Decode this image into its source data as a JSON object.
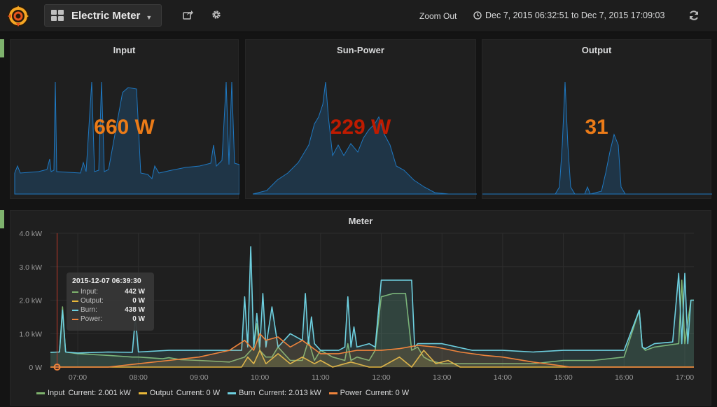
{
  "navbar": {
    "dashboard_title": "Electric Meter",
    "zoom_out_label": "Zoom Out",
    "time_range": "Dec 7, 2015 06:32:51 to Dec 7, 2015 17:09:03"
  },
  "panels": {
    "input": {
      "title": "Input",
      "value": "660 W",
      "color": "#eb7b18"
    },
    "sun_power": {
      "title": "Sun-Power",
      "value": "229 W",
      "color": "#bf1b00"
    },
    "output": {
      "title": "Output",
      "value": "31",
      "color": "#eb7b18"
    }
  },
  "meter": {
    "title": "Meter",
    "tooltip": {
      "time": "2015-12-07 06:39:30",
      "rows": [
        {
          "name": "Input:",
          "value": "442 W",
          "color": "#7eb26d"
        },
        {
          "name": "Output:",
          "value": "0 W",
          "color": "#eab839"
        },
        {
          "name": "Burn:",
          "value": "438 W",
          "color": "#6ed0e0"
        },
        {
          "name": "Power:",
          "value": "0 W",
          "color": "#ef843c"
        }
      ]
    },
    "legend": [
      {
        "name": "Input",
        "current": "Current: 2.001 kW",
        "color": "#7eb26d"
      },
      {
        "name": "Output",
        "current": "Current: 0 W",
        "color": "#eab839"
      },
      {
        "name": "Burn",
        "current": "Current: 2.013 kW",
        "color": "#6ed0e0"
      },
      {
        "name": "Power",
        "current": "Current: 0 W",
        "color": "#ef843c"
      }
    ]
  },
  "chart_data": {
    "type": "line",
    "title": "Meter",
    "y_ticks": [
      "0 W",
      "1.0 kW",
      "2.0 kW",
      "3.0 kW",
      "4.0 kW"
    ],
    "x_ticks": [
      "07:00",
      "08:00",
      "09:00",
      "10:00",
      "11:00",
      "12:00",
      "13:00",
      "14:00",
      "15:00",
      "16:00",
      "17:00"
    ],
    "ylim": [
      0,
      4.0
    ],
    "grid": true,
    "legend_position": "bottom",
    "series": [
      {
        "name": "Input",
        "color": "#7eb26d",
        "x": [
          6.55,
          6.7,
          6.75,
          6.8,
          7.0,
          7.5,
          7.9,
          8.0,
          8.4,
          8.5,
          8.7,
          9.0,
          9.5,
          9.75,
          9.9,
          9.95,
          10.0,
          10.1,
          10.2,
          10.3,
          10.5,
          10.7,
          10.8,
          10.9,
          11.0,
          11.2,
          11.4,
          11.45,
          11.5,
          11.6,
          11.8,
          11.9,
          12.0,
          12.2,
          12.4,
          12.5,
          12.6,
          12.7,
          12.8,
          13.0,
          13.2,
          13.5,
          14.0,
          14.5,
          15.0,
          15.5,
          16.0,
          16.25,
          16.3,
          16.35,
          16.5,
          16.9,
          16.95,
          17.0,
          17.1,
          17.15
        ],
        "y": [
          0.44,
          0.45,
          1.8,
          0.45,
          0.4,
          0.35,
          0.3,
          0.3,
          0.25,
          0.28,
          0.22,
          0.2,
          0.15,
          0.3,
          0.6,
          1.3,
          0.5,
          0.3,
          0.3,
          0.6,
          0.2,
          0.2,
          0.8,
          0.2,
          0.5,
          0.3,
          0.2,
          0.7,
          0.2,
          0.3,
          0.2,
          0.5,
          2.1,
          2.2,
          2.2,
          0.5,
          0.6,
          0.3,
          0.2,
          0.1,
          0.1,
          0.1,
          0.1,
          0.1,
          0.2,
          0.2,
          0.3,
          1.7,
          0.6,
          0.5,
          0.6,
          0.7,
          2.6,
          0.7,
          2.0,
          2.0
        ]
      },
      {
        "name": "Output",
        "color": "#eab839",
        "x": [
          6.55,
          9.7,
          9.8,
          9.9,
          10.0,
          10.1,
          10.3,
          10.5,
          10.7,
          10.9,
          11.0,
          11.2,
          11.5,
          11.8,
          12.0,
          12.3,
          12.5,
          12.7,
          12.9,
          13.1,
          13.3,
          14.0,
          17.15
        ],
        "y": [
          0,
          0,
          0.3,
          0.1,
          0.5,
          0.1,
          0.4,
          0.1,
          0.3,
          0.1,
          0.2,
          0,
          0.15,
          0,
          0,
          0.3,
          0,
          0.5,
          0.1,
          0.2,
          0,
          0,
          0
        ]
      },
      {
        "name": "Burn",
        "color": "#6ed0e0",
        "x": [
          6.55,
          6.7,
          6.75,
          6.8,
          7.0,
          7.5,
          7.9,
          7.95,
          8.0,
          8.5,
          9.0,
          9.5,
          9.7,
          9.75,
          9.8,
          9.85,
          9.9,
          9.95,
          10.0,
          10.05,
          10.1,
          10.2,
          10.3,
          10.5,
          10.7,
          10.75,
          10.8,
          10.85,
          10.9,
          11.0,
          11.1,
          11.3,
          11.4,
          11.45,
          11.5,
          11.55,
          11.6,
          11.8,
          11.9,
          12.0,
          12.1,
          12.3,
          12.5,
          12.55,
          12.6,
          13.0,
          13.5,
          14.0,
          14.5,
          15.0,
          15.5,
          16.0,
          16.25,
          16.3,
          16.35,
          16.5,
          16.8,
          16.9,
          16.95,
          17.0,
          17.05,
          17.1,
          17.15
        ],
        "y": [
          0.44,
          0.45,
          1.7,
          0.45,
          0.42,
          0.45,
          0.44,
          1.5,
          0.45,
          0.5,
          0.5,
          0.5,
          0.5,
          2.1,
          0.6,
          3.6,
          0.6,
          1.6,
          0.6,
          2.2,
          0.6,
          1.8,
          0.6,
          1.0,
          0.8,
          2.2,
          0.7,
          1.5,
          0.7,
          0.5,
          0.5,
          0.5,
          0.6,
          2.1,
          0.6,
          1.2,
          0.6,
          0.7,
          0.6,
          2.6,
          2.6,
          2.6,
          2.6,
          0.6,
          0.7,
          0.7,
          0.5,
          0.5,
          0.45,
          0.5,
          0.5,
          0.5,
          1.7,
          0.6,
          0.55,
          0.7,
          0.75,
          2.8,
          0.7,
          2.8,
          0.7,
          2.0,
          2.0
        ]
      },
      {
        "name": "Power",
        "color": "#ef843c",
        "x": [
          6.55,
          7.5,
          8.0,
          8.5,
          9.0,
          9.5,
          9.75,
          9.9,
          10.0,
          10.1,
          10.3,
          10.5,
          10.7,
          11.0,
          11.3,
          11.6,
          12.0,
          12.3,
          12.6,
          12.9,
          13.3,
          13.7,
          14.0,
          14.5,
          15.0,
          15.1,
          17.15
        ],
        "y": [
          0,
          0,
          0.1,
          0.2,
          0.3,
          0.5,
          0.8,
          0.5,
          1.0,
          0.8,
          0.9,
          0.6,
          0.8,
          0.4,
          0.4,
          0.5,
          0.5,
          0.55,
          0.65,
          0.6,
          0.45,
          0.35,
          0.3,
          0.15,
          0.03,
          0,
          0
        ]
      }
    ]
  }
}
